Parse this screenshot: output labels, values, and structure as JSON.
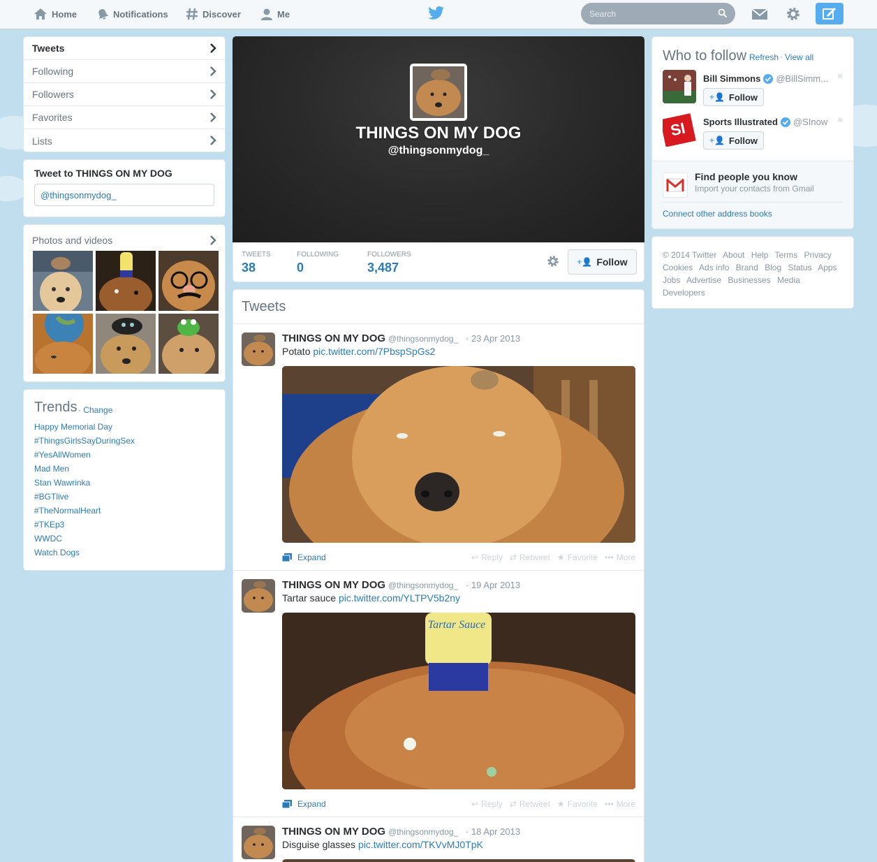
{
  "nav": {
    "home": "Home",
    "notifications": "Notifications",
    "discover": "Discover",
    "me": "Me",
    "search_placeholder": "Search"
  },
  "sidebar": {
    "items": [
      {
        "label": "Tweets"
      },
      {
        "label": "Following"
      },
      {
        "label": "Followers"
      },
      {
        "label": "Favorites"
      },
      {
        "label": "Lists"
      }
    ]
  },
  "tweet_to": {
    "title": "Tweet to THINGS ON MY DOG",
    "value": "@thingsonmydog_"
  },
  "photos": {
    "title": "Photos and videos"
  },
  "trends": {
    "title": "Trends",
    "change": "· Change",
    "items": [
      "Happy Memorial Day",
      "#ThingsGirlsSayDuringSex",
      "#YesAllWomen",
      "Mad Men",
      "Stan Wawrinka",
      "#BGTlive",
      "#TheNormalHeart",
      "#TKEp3",
      "WWDC",
      "Watch Dogs"
    ]
  },
  "profile": {
    "name": "THINGS ON MY DOG",
    "handle": "@thingsonmydog_",
    "stats": {
      "tweets_label": "TWEETS",
      "tweets": "38",
      "following_label": "FOLLOWING",
      "following": "0",
      "followers_label": "FOLLOWERS",
      "followers": "3,487"
    },
    "follow_label": "Follow"
  },
  "stream": {
    "title": "Tweets",
    "tweets": [
      {
        "name": "THINGS ON MY DOG",
        "handle": "@thingsonmydog_",
        "time": "· 23 Apr 2013",
        "text": "Potato ",
        "link": "pic.twitter.com/7PbspSpGs2"
      },
      {
        "name": "THINGS ON MY DOG",
        "handle": "@thingsonmydog_",
        "time": "· 19 Apr 2013",
        "text": "Tartar sauce ",
        "link": "pic.twitter.com/YLTPV5b2ny"
      },
      {
        "name": "THINGS ON MY DOG",
        "handle": "@thingsonmydog_",
        "time": "· 18 Apr 2013",
        "text": "Disguise glasses ",
        "link": "pic.twitter.com/TKVvMJ0TpK"
      }
    ],
    "expand": "Expand",
    "reply": "Reply",
    "retweet": "Retweet",
    "favorite": "Favorite",
    "more": "More",
    "media_text": "Tartar Sauce"
  },
  "who_to_follow": {
    "title": "Who to follow",
    "refresh": "Refresh",
    "view_all": "View all",
    "suggestions": [
      {
        "name": "Bill Simmons",
        "handle": "@BillSimm...",
        "follow": "Follow"
      },
      {
        "name": "Sports Illustrated",
        "handle": "@SInow",
        "follow": "Follow"
      }
    ],
    "find_title": "Find people you know",
    "find_sub": "Import your contacts from Gmail",
    "connect": "Connect other address books",
    "close": "×"
  },
  "footer": {
    "links": [
      "© 2014 Twitter",
      "About",
      "Help",
      "Terms",
      "Privacy",
      "Cookies",
      "Ads info",
      "Brand",
      "Blog",
      "Status",
      "Apps",
      "Jobs",
      "Advertise",
      "Businesses",
      "Media",
      "Developers"
    ]
  },
  "colors": {
    "link": "#2b7bb9",
    "accent": "#55acee",
    "background": "#c0deed"
  }
}
